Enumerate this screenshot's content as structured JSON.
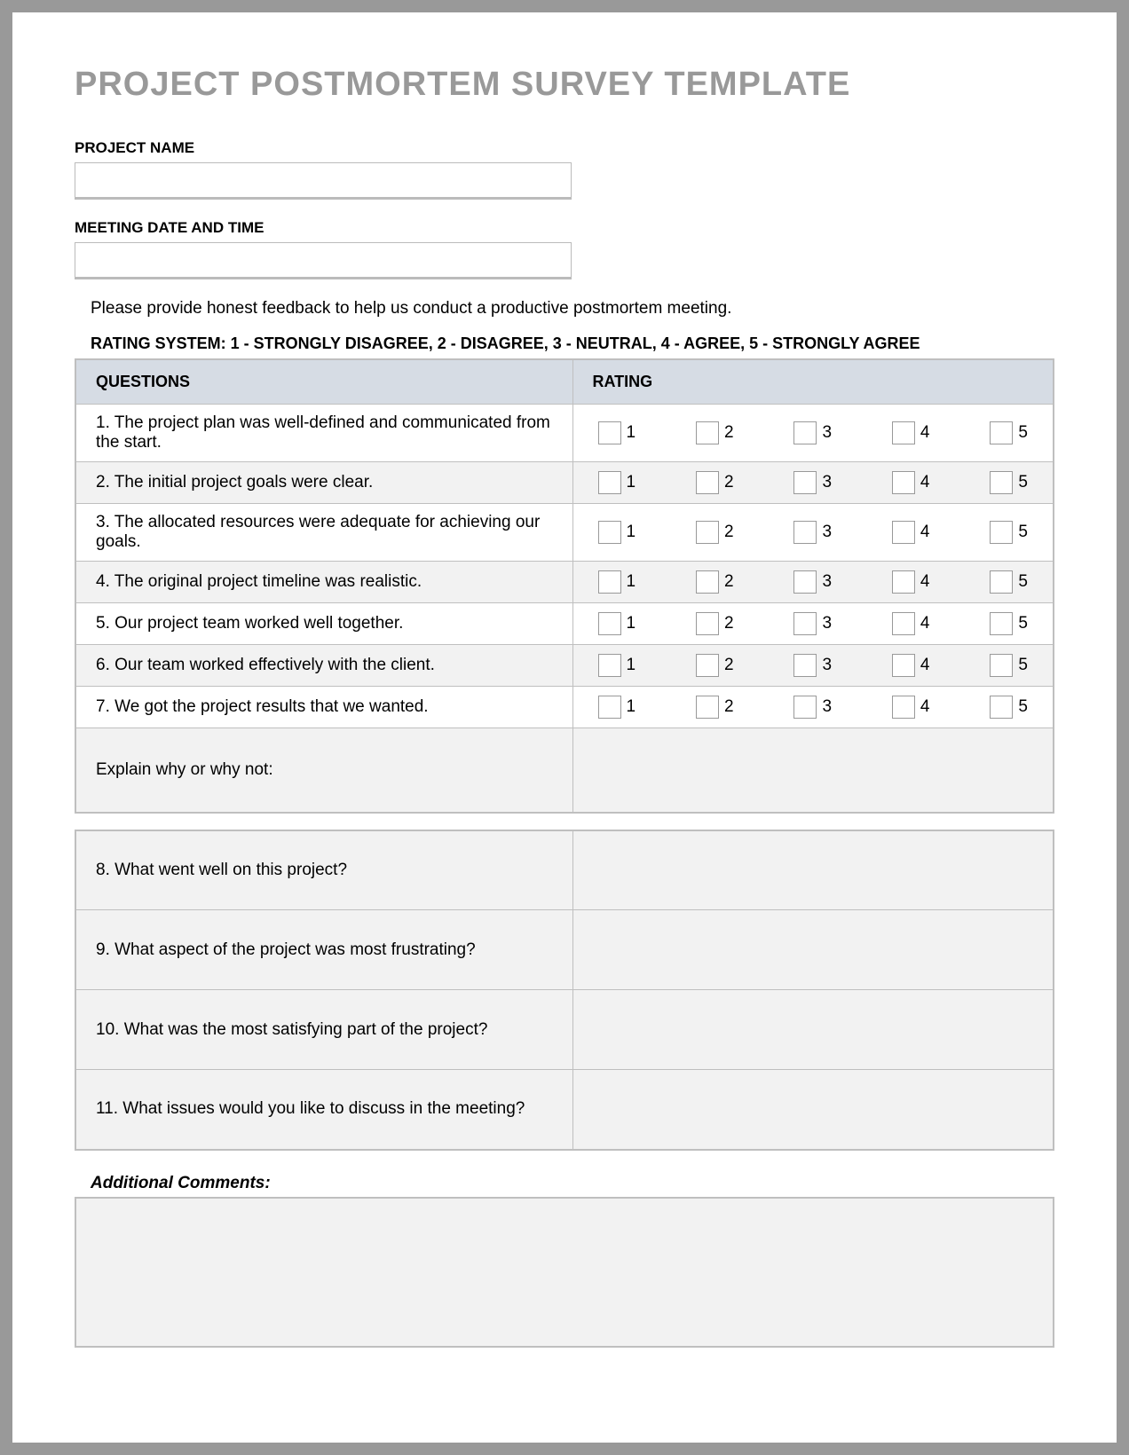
{
  "title": "PROJECT POSTMORTEM SURVEY TEMPLATE",
  "fields": {
    "project_name_label": "PROJECT NAME",
    "project_name_value": "",
    "meeting_label": "MEETING DATE AND TIME",
    "meeting_value": ""
  },
  "instructions": "Please provide honest feedback to help us conduct a productive postmortem meeting.",
  "rating_legend": "RATING SYSTEM: 1 - STRONGLY DISAGREE, 2 - DISAGREE, 3 - NEUTRAL, 4 - AGREE, 5 - STRONGLY AGREE",
  "headers": {
    "questions": "QUESTIONS",
    "rating": "RATING"
  },
  "rating_values": [
    "1",
    "2",
    "3",
    "4",
    "5"
  ],
  "rating_questions": [
    "1. The project plan was well-defined and communicated from the start.",
    "2. The initial project goals were clear.",
    "3. The allocated resources were adequate for achieving our goals.",
    "4. The original project timeline was realistic.",
    "5. Our project team worked well together.",
    "6. Our team worked effectively with the client.",
    "7. We got the project results that we wanted."
  ],
  "explain_label": "Explain why or why not:",
  "open_questions": [
    "8. What went well on this project?",
    "9. What aspect of the project was most frustrating?",
    "10. What was the most satisfying part of the project?",
    "11. What issues would you like to discuss in the meeting?"
  ],
  "additional_comments_label": "Additional Comments:",
  "additional_comments_value": ""
}
